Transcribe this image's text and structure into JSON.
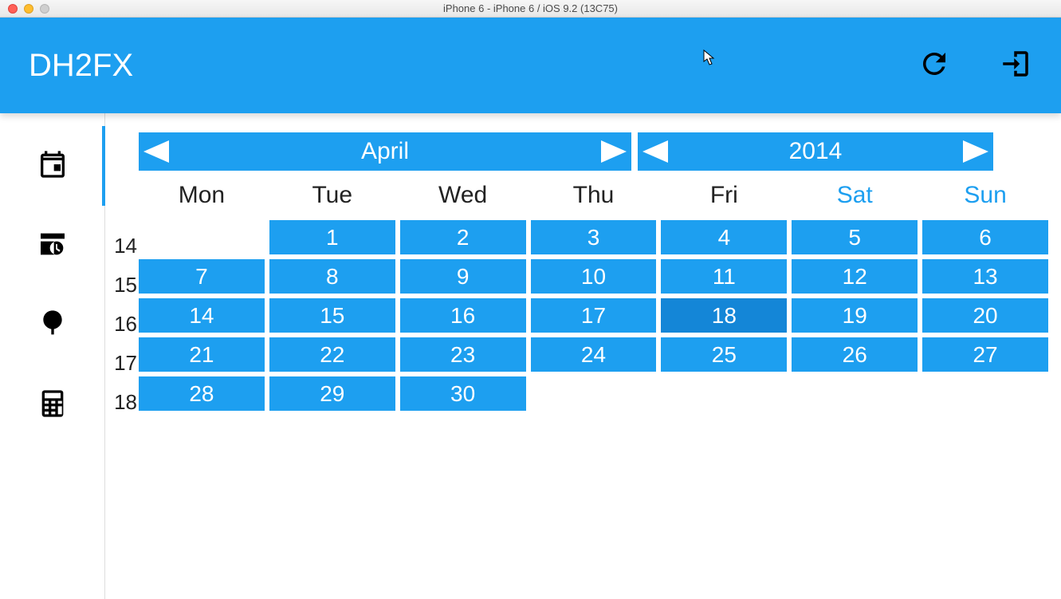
{
  "window": {
    "title": "iPhone 6 - iPhone 6 / iOS 9.2 (13C75)"
  },
  "header": {
    "app_title": "DH2FX",
    "icons": {
      "refresh": "refresh-icon",
      "exit": "exit-icon"
    }
  },
  "sidebar": {
    "items": [
      {
        "name": "calendar",
        "active": true
      },
      {
        "name": "schedule",
        "active": false
      },
      {
        "name": "tree",
        "active": false
      },
      {
        "name": "calculator",
        "active": false
      }
    ]
  },
  "calendar": {
    "month_label": "April",
    "year_label": "2014",
    "day_headers": [
      "Mon",
      "Tue",
      "Wed",
      "Thu",
      "Fri",
      "Sat",
      "Sun"
    ],
    "weekend_indices": [
      5,
      6
    ],
    "week_numbers": [
      "14",
      "15",
      "16",
      "17",
      "18"
    ],
    "selected_day": 18,
    "leading_blanks": 1,
    "days_in_month": 30
  }
}
